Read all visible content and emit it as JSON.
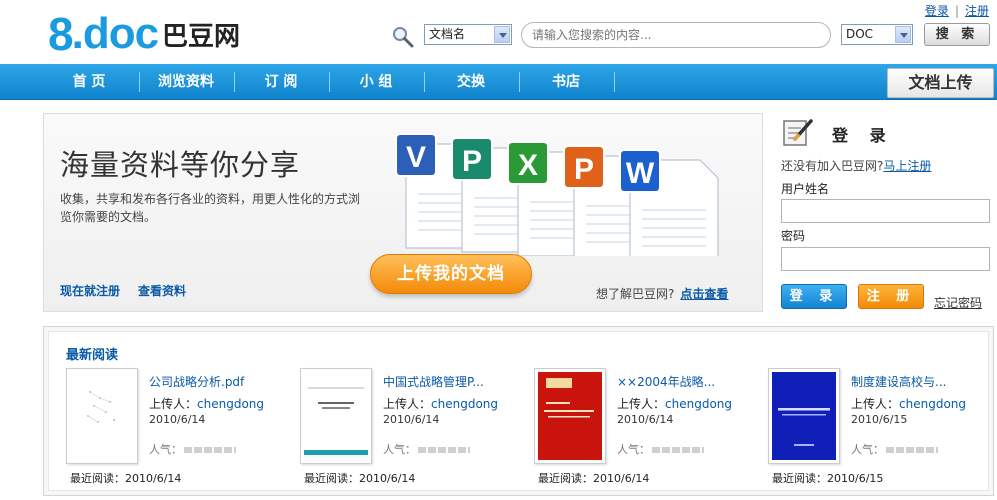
{
  "logo": {
    "eight": "8",
    "doc": ".doc",
    "cn": "巴豆网"
  },
  "toplinks": {
    "login": "登录",
    "sep": "|",
    "register": "注册"
  },
  "search": {
    "doctype_selected": "文档名",
    "placeholder": "请输入您搜索的内容...",
    "format_selected": "DOC",
    "button": "搜 索"
  },
  "nav": {
    "items": [
      {
        "label": "首 页"
      },
      {
        "label": "浏览资料"
      },
      {
        "label": "订 阅"
      },
      {
        "label": "小 组"
      },
      {
        "label": "交换"
      },
      {
        "label": "书店"
      }
    ],
    "upload": "文档上传"
  },
  "banner": {
    "title": "海量资料等你分享",
    "desc": "收集，共享和发布各行各业的资料，用更人性化的方式浏览你需要的文档。",
    "link_register": "现在就注册",
    "link_browse": "查看资料",
    "upload_btn": "上传我的文档",
    "learn_text": "想了解巴豆网?",
    "learn_link": "点击查看",
    "doc_letters": [
      "V",
      "P",
      "X",
      "P",
      "W"
    ],
    "doc_colors": [
      "#2d5fb8",
      "#1a8a6e",
      "#2a9a36",
      "#e0621a",
      "#1c5fcf"
    ]
  },
  "login": {
    "title": "登 录",
    "hint": "还没有加入巴豆网?",
    "hint_link": "马上注册",
    "username_label": "用户姓名",
    "password_label": "密码",
    "login_btn": "登 录",
    "register_btn": "注 册",
    "forgot": "忘记密码"
  },
  "latest": {
    "title": "最新阅读",
    "items": [
      {
        "name": "公司战略分析.pdf",
        "uploader_label": "上传人：",
        "uploader": "chengdong",
        "date": "2010/6/14",
        "pop_label": "人气：",
        "recent": "最近阅读：2010/6/14"
      },
      {
        "name": "中国式战略管理P...",
        "uploader_label": "上传人：",
        "uploader": "chengdong",
        "date": "2010/6/14",
        "pop_label": "人气：",
        "recent": "最近阅读：2010/6/14"
      },
      {
        "name": "××2004年战略...",
        "uploader_label": "上传人：",
        "uploader": "chengdong",
        "date": "2010/6/14",
        "pop_label": "人气：",
        "recent": "最近阅读：2010/6/14"
      },
      {
        "name": "制度建设高校与...",
        "uploader_label": "上传人：",
        "uploader": "chengdong",
        "date": "2010/6/15",
        "pop_label": "人气：",
        "recent": "最近阅读：2010/6/15"
      }
    ]
  }
}
